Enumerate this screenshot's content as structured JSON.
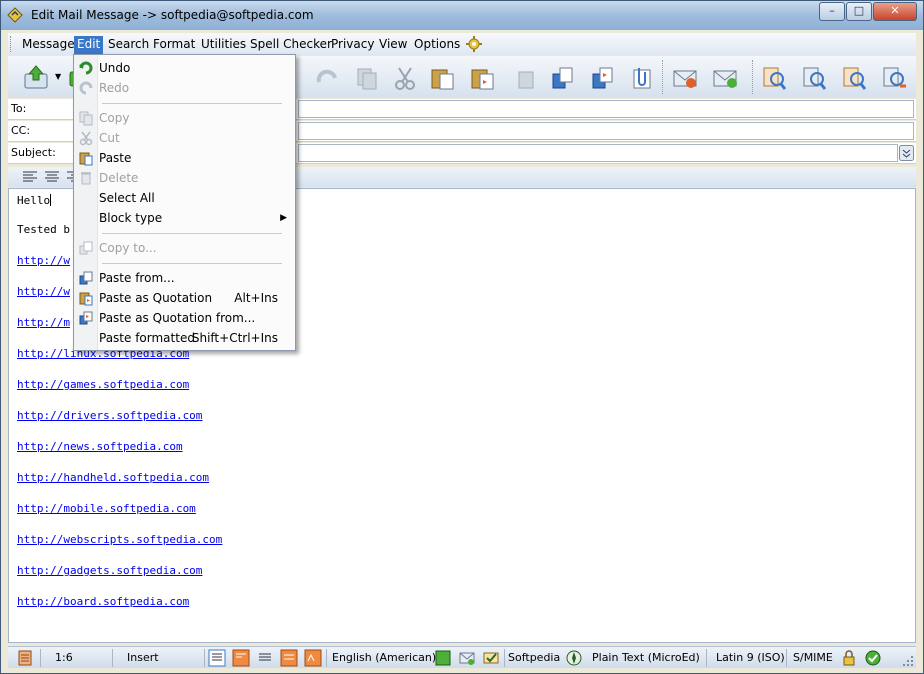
{
  "window": {
    "title": "Edit Mail Message -> softpedia@softpedia.com",
    "minimize": "–",
    "maximize": "□",
    "close": "✕"
  },
  "menubar": {
    "items": [
      {
        "label": "Message"
      },
      {
        "label": "Edit"
      },
      {
        "label": "Search"
      },
      {
        "label": "Format"
      },
      {
        "label": "Utilities"
      },
      {
        "label": "Spell Checker"
      },
      {
        "label": "Privacy"
      },
      {
        "label": "View"
      },
      {
        "label": "Options"
      }
    ],
    "active": "Edit"
  },
  "fields": {
    "to_label": "To:",
    "cc_label": "CC:",
    "subject_label": "Subject:"
  },
  "editor": {
    "lines": [
      "Hello",
      "Tested b"
    ],
    "links": [
      "http://w",
      "http://w",
      "http://m",
      "http://linux.softpedia.com",
      "http://games.softpedia.com",
      "http://drivers.softpedia.com",
      "http://news.softpedia.com",
      "http://handheld.softpedia.com",
      "http://mobile.softpedia.com",
      "http://webscripts.softpedia.com",
      "http://gadgets.softpedia.com",
      "http://board.softpedia.com"
    ]
  },
  "edit_menu": {
    "items": [
      {
        "label": "Undo",
        "shortcut": "",
        "enabled": true,
        "icon": "undo-icon"
      },
      {
        "label": "Redo",
        "shortcut": "",
        "enabled": false,
        "icon": "redo-icon"
      },
      {
        "label": "Copy",
        "shortcut": "",
        "enabled": false,
        "icon": "copy-icon"
      },
      {
        "label": "Cut",
        "shortcut": "",
        "enabled": false,
        "icon": "cut-icon"
      },
      {
        "label": "Paste",
        "shortcut": "",
        "enabled": true,
        "icon": "paste-icon"
      },
      {
        "label": "Delete",
        "shortcut": "",
        "enabled": false,
        "icon": "delete-icon"
      },
      {
        "label": "Select All",
        "shortcut": "",
        "enabled": true,
        "icon": ""
      },
      {
        "label": "Block type",
        "shortcut": "",
        "enabled": true,
        "icon": "",
        "submenu": true
      },
      {
        "label": "Copy to...",
        "shortcut": "",
        "enabled": false,
        "icon": "copy-to-icon"
      },
      {
        "label": "Paste from...",
        "shortcut": "",
        "enabled": true,
        "icon": "paste-from-icon"
      },
      {
        "label": "Paste as Quotation",
        "shortcut": "Alt+Ins",
        "enabled": true,
        "icon": "paste-quotation-icon"
      },
      {
        "label": "Paste as Quotation from...",
        "shortcut": "",
        "enabled": true,
        "icon": "paste-quotation-from-icon"
      },
      {
        "label": "Paste formatted",
        "shortcut": "Shift+Ctrl+Ins",
        "enabled": true,
        "icon": ""
      }
    ]
  },
  "statusbar": {
    "position": "1:6",
    "mode": "Insert",
    "language": "English (American)",
    "signature": "Softpedia",
    "editor_type": "Plain Text (MicroEd)",
    "charset": "Latin 9 (ISO)",
    "security": "S/MIME"
  },
  "colors": {
    "accent": "#3a77c7",
    "link": "#0000ee",
    "disabled": "#a0a0a0"
  }
}
